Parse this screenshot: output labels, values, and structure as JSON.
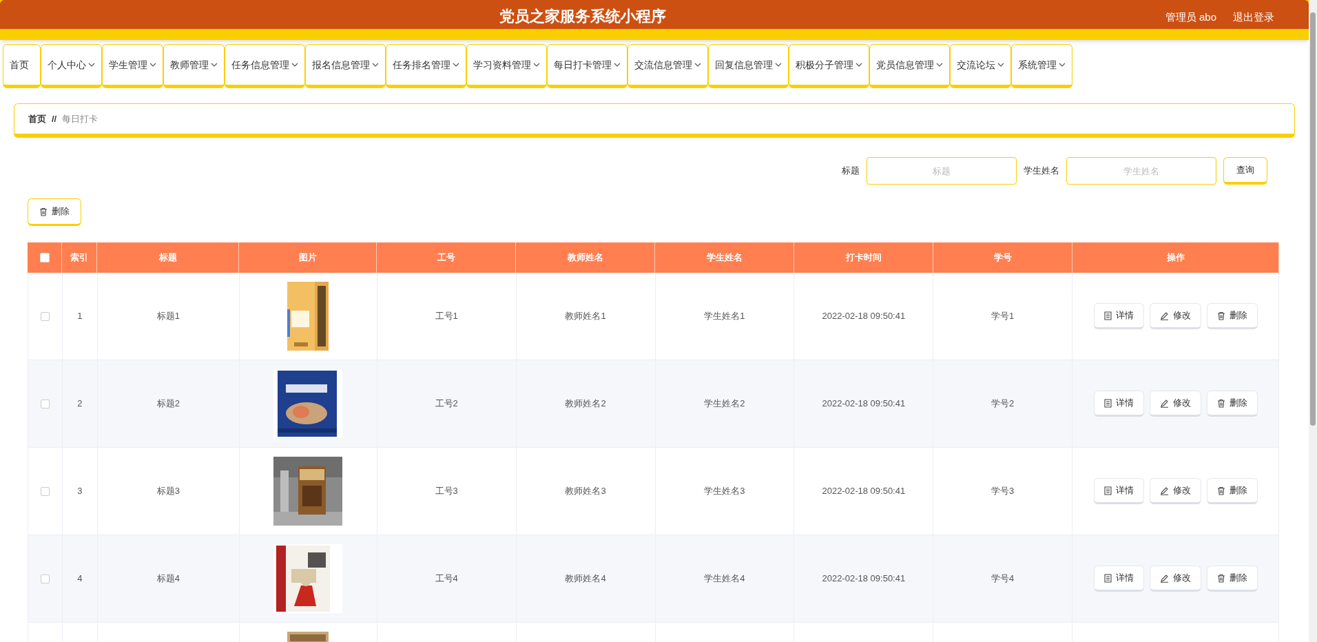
{
  "header": {
    "title": "党员之家服务系统小程序",
    "user": "管理员 abo",
    "logout": "退出登录"
  },
  "nav": [
    {
      "label": "首页",
      "dropdown": false
    },
    {
      "label": "个人中心",
      "dropdown": true
    },
    {
      "label": "学生管理",
      "dropdown": true
    },
    {
      "label": "教师管理",
      "dropdown": true
    },
    {
      "label": "任务信息管理",
      "dropdown": true
    },
    {
      "label": "报名信息管理",
      "dropdown": true
    },
    {
      "label": "任务排名管理",
      "dropdown": true
    },
    {
      "label": "学习资料管理",
      "dropdown": true
    },
    {
      "label": "每日打卡管理",
      "dropdown": true
    },
    {
      "label": "交流信息管理",
      "dropdown": true
    },
    {
      "label": "回复信息管理",
      "dropdown": true
    },
    {
      "label": "积极分子管理",
      "dropdown": true
    },
    {
      "label": "党员信息管理",
      "dropdown": true
    },
    {
      "label": "交流论坛",
      "dropdown": true
    },
    {
      "label": "系统管理",
      "dropdown": true
    }
  ],
  "breadcrumb": {
    "home": "首页",
    "separator": "//",
    "current": "每日打卡"
  },
  "search": {
    "fields": [
      {
        "label": "标题",
        "placeholder": "标题"
      },
      {
        "label": "学生姓名",
        "placeholder": "学生姓名"
      }
    ],
    "button": "查询"
  },
  "delete_button": "删除",
  "table": {
    "header_checked": false,
    "columns": [
      "索引",
      "标题",
      "图片",
      "工号",
      "教师姓名",
      "学生姓名",
      "打卡时间",
      "学号",
      "操作"
    ],
    "rows": [
      {
        "checked": false,
        "index": "1",
        "title": "标题1",
        "image": {
          "kind": "picture"
        },
        "staff_no": "工号1",
        "teacher": "教师姓名1",
        "student": "学生姓名1",
        "time": "2022-02-18 09:50:41",
        "student_no": "学号1",
        "actions": [
          "详情",
          "修改",
          "删除"
        ]
      },
      {
        "checked": false,
        "index": "2",
        "title": "标题2",
        "image": {
          "kind": "picture"
        },
        "staff_no": "工号2",
        "teacher": "教师姓名2",
        "student": "学生姓名2",
        "time": "2022-02-18 09:50:41",
        "student_no": "学号2",
        "actions": [
          "详情",
          "修改",
          "删除"
        ]
      },
      {
        "checked": false,
        "index": "3",
        "title": "标题3",
        "image": {
          "kind": "picture"
        },
        "staff_no": "工号3",
        "teacher": "教师姓名3",
        "student": "学生姓名3",
        "time": "2022-02-18 09:50:41",
        "student_no": "学号3",
        "actions": [
          "详情",
          "修改",
          "删除"
        ]
      },
      {
        "checked": false,
        "index": "4",
        "title": "标题4",
        "image": {
          "kind": "picture"
        },
        "staff_no": "工号4",
        "teacher": "教师姓名4",
        "student": "学生姓名4",
        "time": "2022-02-18 09:50:41",
        "student_no": "学号4",
        "actions": [
          "详情",
          "修改",
          "删除"
        ]
      }
    ],
    "partial_row": {
      "image": {
        "kind": "picture"
      }
    }
  }
}
